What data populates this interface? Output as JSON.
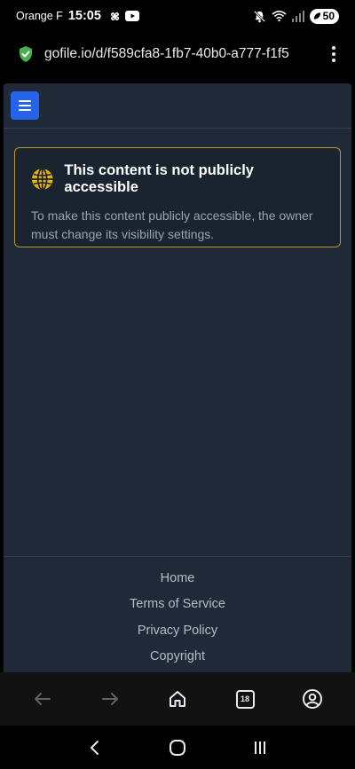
{
  "status_bar": {
    "carrier": "Orange F",
    "time": "15:05",
    "battery": "50"
  },
  "url_bar": {
    "url": "gofile.io/d/f589cfa8-1fb7-40b0-a777-f1f5"
  },
  "alert": {
    "title": "This content is not publicly accessible",
    "message": "To make this content publicly accessible, the owner must change its visibility settings."
  },
  "footer": {
    "links": [
      "Home",
      "Terms of Service",
      "Privacy Policy",
      "Copyright"
    ]
  },
  "browser_toolbar": {
    "tab_count": "18"
  },
  "colors": {
    "page_bg": "#1f2937",
    "menu_button": "#2563eb",
    "alert_border": "#b8962d",
    "globe_icon": "#eab308"
  }
}
